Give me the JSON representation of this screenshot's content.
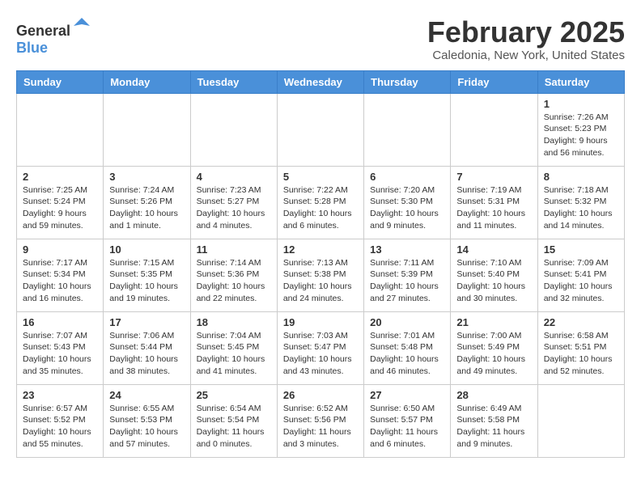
{
  "logo": {
    "general": "General",
    "blue": "Blue"
  },
  "title": "February 2025",
  "location": "Caledonia, New York, United States",
  "days_of_week": [
    "Sunday",
    "Monday",
    "Tuesday",
    "Wednesday",
    "Thursday",
    "Friday",
    "Saturday"
  ],
  "weeks": [
    [
      {
        "day": "",
        "info": ""
      },
      {
        "day": "",
        "info": ""
      },
      {
        "day": "",
        "info": ""
      },
      {
        "day": "",
        "info": ""
      },
      {
        "day": "",
        "info": ""
      },
      {
        "day": "",
        "info": ""
      },
      {
        "day": "1",
        "info": "Sunrise: 7:26 AM\nSunset: 5:23 PM\nDaylight: 9 hours\nand 56 minutes."
      }
    ],
    [
      {
        "day": "2",
        "info": "Sunrise: 7:25 AM\nSunset: 5:24 PM\nDaylight: 9 hours\nand 59 minutes."
      },
      {
        "day": "3",
        "info": "Sunrise: 7:24 AM\nSunset: 5:26 PM\nDaylight: 10 hours\nand 1 minute."
      },
      {
        "day": "4",
        "info": "Sunrise: 7:23 AM\nSunset: 5:27 PM\nDaylight: 10 hours\nand 4 minutes."
      },
      {
        "day": "5",
        "info": "Sunrise: 7:22 AM\nSunset: 5:28 PM\nDaylight: 10 hours\nand 6 minutes."
      },
      {
        "day": "6",
        "info": "Sunrise: 7:20 AM\nSunset: 5:30 PM\nDaylight: 10 hours\nand 9 minutes."
      },
      {
        "day": "7",
        "info": "Sunrise: 7:19 AM\nSunset: 5:31 PM\nDaylight: 10 hours\nand 11 minutes."
      },
      {
        "day": "8",
        "info": "Sunrise: 7:18 AM\nSunset: 5:32 PM\nDaylight: 10 hours\nand 14 minutes."
      }
    ],
    [
      {
        "day": "9",
        "info": "Sunrise: 7:17 AM\nSunset: 5:34 PM\nDaylight: 10 hours\nand 16 minutes."
      },
      {
        "day": "10",
        "info": "Sunrise: 7:15 AM\nSunset: 5:35 PM\nDaylight: 10 hours\nand 19 minutes."
      },
      {
        "day": "11",
        "info": "Sunrise: 7:14 AM\nSunset: 5:36 PM\nDaylight: 10 hours\nand 22 minutes."
      },
      {
        "day": "12",
        "info": "Sunrise: 7:13 AM\nSunset: 5:38 PM\nDaylight: 10 hours\nand 24 minutes."
      },
      {
        "day": "13",
        "info": "Sunrise: 7:11 AM\nSunset: 5:39 PM\nDaylight: 10 hours\nand 27 minutes."
      },
      {
        "day": "14",
        "info": "Sunrise: 7:10 AM\nSunset: 5:40 PM\nDaylight: 10 hours\nand 30 minutes."
      },
      {
        "day": "15",
        "info": "Sunrise: 7:09 AM\nSunset: 5:41 PM\nDaylight: 10 hours\nand 32 minutes."
      }
    ],
    [
      {
        "day": "16",
        "info": "Sunrise: 7:07 AM\nSunset: 5:43 PM\nDaylight: 10 hours\nand 35 minutes."
      },
      {
        "day": "17",
        "info": "Sunrise: 7:06 AM\nSunset: 5:44 PM\nDaylight: 10 hours\nand 38 minutes."
      },
      {
        "day": "18",
        "info": "Sunrise: 7:04 AM\nSunset: 5:45 PM\nDaylight: 10 hours\nand 41 minutes."
      },
      {
        "day": "19",
        "info": "Sunrise: 7:03 AM\nSunset: 5:47 PM\nDaylight: 10 hours\nand 43 minutes."
      },
      {
        "day": "20",
        "info": "Sunrise: 7:01 AM\nSunset: 5:48 PM\nDaylight: 10 hours\nand 46 minutes."
      },
      {
        "day": "21",
        "info": "Sunrise: 7:00 AM\nSunset: 5:49 PM\nDaylight: 10 hours\nand 49 minutes."
      },
      {
        "day": "22",
        "info": "Sunrise: 6:58 AM\nSunset: 5:51 PM\nDaylight: 10 hours\nand 52 minutes."
      }
    ],
    [
      {
        "day": "23",
        "info": "Sunrise: 6:57 AM\nSunset: 5:52 PM\nDaylight: 10 hours\nand 55 minutes."
      },
      {
        "day": "24",
        "info": "Sunrise: 6:55 AM\nSunset: 5:53 PM\nDaylight: 10 hours\nand 57 minutes."
      },
      {
        "day": "25",
        "info": "Sunrise: 6:54 AM\nSunset: 5:54 PM\nDaylight: 11 hours\nand 0 minutes."
      },
      {
        "day": "26",
        "info": "Sunrise: 6:52 AM\nSunset: 5:56 PM\nDaylight: 11 hours\nand 3 minutes."
      },
      {
        "day": "27",
        "info": "Sunrise: 6:50 AM\nSunset: 5:57 PM\nDaylight: 11 hours\nand 6 minutes."
      },
      {
        "day": "28",
        "info": "Sunrise: 6:49 AM\nSunset: 5:58 PM\nDaylight: 11 hours\nand 9 minutes."
      },
      {
        "day": "",
        "info": ""
      }
    ]
  ]
}
